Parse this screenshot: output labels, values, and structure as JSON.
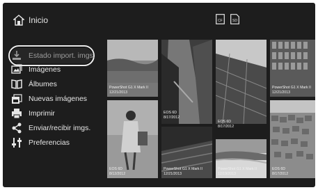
{
  "header": {
    "title": "Inicio",
    "icons": [
      "home-icon",
      "sd-card-cf-icon",
      "sd-card-sd-icon"
    ],
    "card_labels": [
      "CF",
      "SD"
    ]
  },
  "sidebar": {
    "items": [
      {
        "label": "Estado import. imgs.",
        "icon": "import-status-icon",
        "selected": true
      },
      {
        "label": "Imágenes",
        "icon": "images-icon"
      },
      {
        "label": "Álbumes",
        "icon": "albums-icon"
      },
      {
        "label": "Nuevas imágenes",
        "icon": "new-images-icon"
      },
      {
        "label": "Imprimir",
        "icon": "printer-icon"
      },
      {
        "label": "Enviar/recibir imgs.",
        "icon": "share-icon"
      },
      {
        "label": "Preferencias",
        "icon": "preferences-icon"
      }
    ]
  },
  "thumbnails": [
    {
      "camera": "PowerShot G1 X Mark II",
      "date": "12/21/2013"
    },
    {
      "camera": "",
      "date": ""
    },
    {
      "camera": "",
      "date": ""
    },
    {
      "camera": "PowerShot G1 X Mark II",
      "date": "12/21/2013"
    },
    {
      "camera": "EOS 6D",
      "date": "8/17/2012"
    },
    {
      "camera": "EOS 6D",
      "date": "8/17/2012"
    },
    {
      "camera": "EOS 6D",
      "date": "8/12/2012"
    },
    {
      "camera": "PowerShot G1 X Mark II",
      "date": "12/21/2013"
    },
    {
      "camera": "PowerShot G1 X Mark II",
      "date": "12/19/2013"
    },
    {
      "camera": "EOS 6D",
      "date": "8/17/2012"
    }
  ],
  "colors": {
    "background": "#1d1d1d",
    "text": "#e6e6e6",
    "highlight_ring": "#ececec"
  }
}
